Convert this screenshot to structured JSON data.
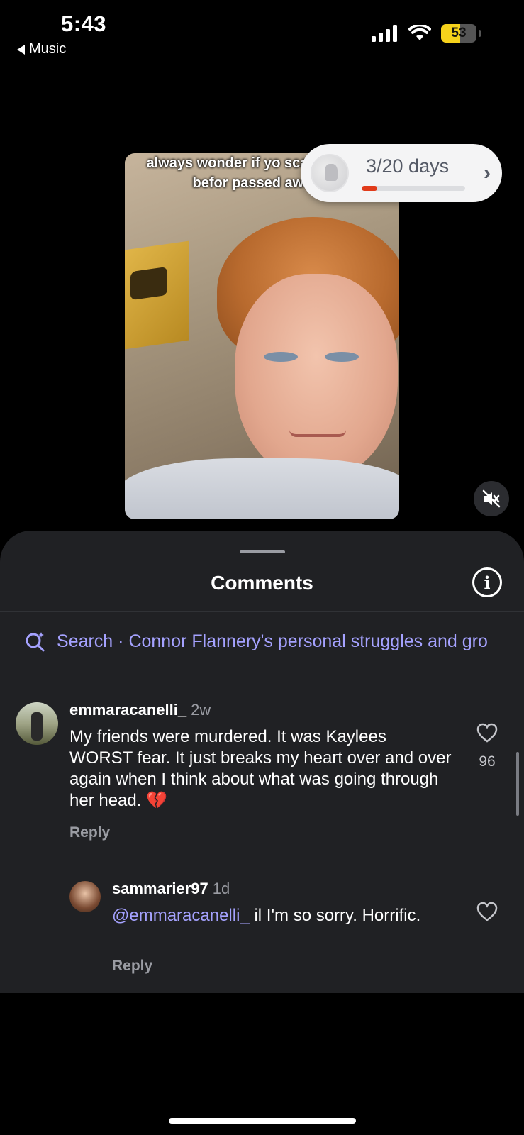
{
  "status_bar": {
    "time": "5:43",
    "back_app": "Music",
    "battery_level": "53",
    "battery_fraction": 0.53
  },
  "video": {
    "caption": "always wonder if yo scared right befor passed away"
  },
  "streak": {
    "text": "3/20 days",
    "progress_fraction": 0.15
  },
  "comments_sheet": {
    "title": "Comments",
    "search_prefix": "Search",
    "search_term": "Connor Flannery's personal struggles and gro",
    "comments": [
      {
        "username": "emmaracanelli_",
        "age": "2w",
        "text": "My friends were murdered. It was Kaylees WORST fear. It just breaks my heart over and over again when I think about what was going through her head. 💔",
        "likes": "96",
        "reply_label": "Reply"
      },
      {
        "username": "sammarier97",
        "age": "1d",
        "mention": "@emmaracanelli_",
        "text": " il I'm so sorry. Horrific.",
        "reply_label": "Reply"
      }
    ]
  },
  "colors": {
    "accent": "#a5a2ff",
    "sheet_bg": "#202124",
    "streak_progress": "#e13b1a",
    "battery": "#f6d21b"
  }
}
